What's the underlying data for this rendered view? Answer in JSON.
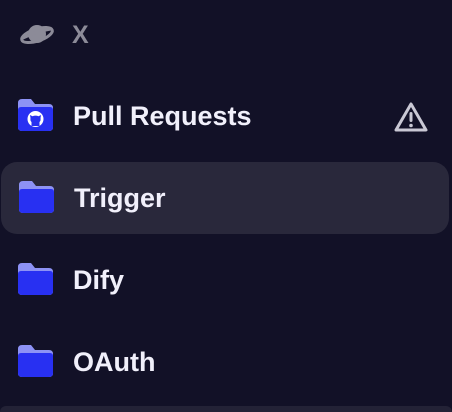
{
  "topbar": {
    "planet_icon": "planet-icon",
    "close_label": "X"
  },
  "tree": {
    "items": [
      {
        "label": "Pull Requests",
        "icon": "github-folder-icon",
        "status_icon": "warning-icon",
        "selected": false
      },
      {
        "label": "Trigger",
        "icon": "folder-icon",
        "selected": true
      },
      {
        "label": "Dify",
        "icon": "folder-icon",
        "selected": false
      },
      {
        "label": "OAuth",
        "icon": "folder-icon",
        "selected": false
      }
    ]
  },
  "colors": {
    "background": "#121127",
    "selected_row": "#29283b",
    "folder_back": "#8d92f5",
    "folder_front": "#2830f2",
    "text": "#f1f0fb",
    "muted": "#8c8b98"
  }
}
